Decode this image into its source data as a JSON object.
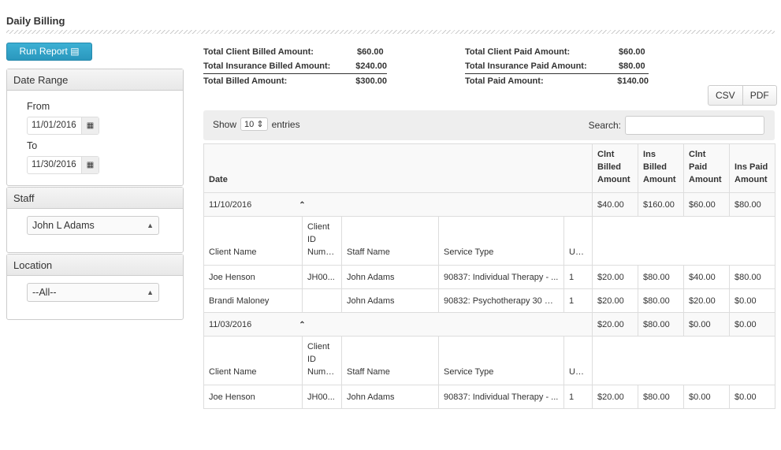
{
  "page": {
    "title": "Daily Billing",
    "run_report": "Run Report"
  },
  "filters": {
    "date_range": {
      "title": "Date Range",
      "from_label": "From",
      "from": "11/01/2016",
      "to_label": "To",
      "to": "11/30/2016"
    },
    "staff": {
      "title": "Staff",
      "value": "John L Adams"
    },
    "location": {
      "title": "Location",
      "value": "--All--"
    }
  },
  "totals": {
    "left": [
      {
        "label": "Total Client Billed Amount:",
        "value": "$60.00"
      },
      {
        "label": "Total Insurance Billed Amount:",
        "value": "$240.00"
      },
      {
        "label": "Total Billed Amount:",
        "value": "$300.00"
      }
    ],
    "right": [
      {
        "label": "Total Client Paid Amount:",
        "value": "$60.00"
      },
      {
        "label": "Total Insurance Paid Amount:",
        "value": "$80.00"
      },
      {
        "label": "Total Paid Amount:",
        "value": "$140.00"
      }
    ]
  },
  "export": {
    "csv": "CSV",
    "pdf": "PDF"
  },
  "table_controls": {
    "show": "Show",
    "entries_value": "10",
    "entries": "entries",
    "search": "Search:"
  },
  "table": {
    "headers": [
      "Date",
      "Clnt Billed Amount",
      "Ins Billed Amount",
      "Clnt Paid Amount",
      "Ins Paid Amount"
    ],
    "sub_headers": [
      "Client Name",
      "Client ID Number",
      "Staff Name",
      "Service Type",
      "Units"
    ],
    "groups": [
      {
        "date": "11/10/2016",
        "totals": [
          "$40.00",
          "$160.00",
          "$60.00",
          "$80.00"
        ],
        "rows": [
          [
            "Joe Henson",
            "JH00...",
            "John Adams",
            "90837: Individual Therapy - ...",
            "1",
            "$20.00",
            "$80.00",
            "$40.00",
            "$80.00"
          ],
          [
            "Brandi Maloney",
            "",
            "John Adams",
            "90832: Psychotherapy 30 mins",
            "1",
            "$20.00",
            "$80.00",
            "$20.00",
            "$0.00"
          ]
        ]
      },
      {
        "date": "11/03/2016",
        "totals": [
          "$20.00",
          "$80.00",
          "$0.00",
          "$0.00"
        ],
        "rows": [
          [
            "Joe Henson",
            "JH00...",
            "John Adams",
            "90837: Individual Therapy - ...",
            "1",
            "$20.00",
            "$80.00",
            "$0.00",
            "$0.00"
          ]
        ]
      }
    ]
  }
}
